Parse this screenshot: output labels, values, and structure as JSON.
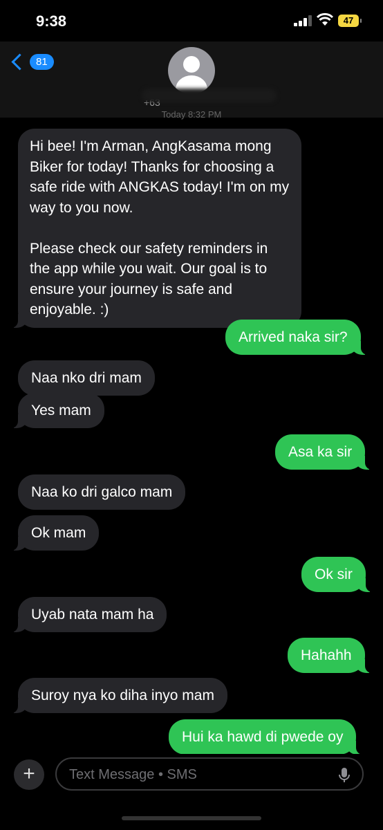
{
  "status_bar": {
    "time": "9:38",
    "battery": "47"
  },
  "header": {
    "back_count": "81",
    "contact_partial": "+63"
  },
  "timestamp": "Today 8:32 PM",
  "messages": [
    {
      "dir": "in",
      "text": "Hi bee! I'm Arman, AngKasama mong Biker for today! Thanks for choosing a safe ride with ANGKAS today! I'm on my way to you now.\n\nPlease check our safety reminders in the app while you wait. Our goal is to ensure your journey is safe and enjoyable. :)"
    },
    {
      "dir": "out",
      "text": "Arrived naka sir?"
    },
    {
      "dir": "in",
      "text": "Naa nko dri mam"
    },
    {
      "dir": "in",
      "text": "Yes mam"
    },
    {
      "dir": "out",
      "text": "Asa ka sir"
    },
    {
      "dir": "in",
      "text": "Naa ko dri galco mam"
    },
    {
      "dir": "in",
      "text": "Ok mam"
    },
    {
      "dir": "out",
      "text": "Ok sir"
    },
    {
      "dir": "in",
      "text": "Uyab nata mam ha"
    },
    {
      "dir": "out",
      "text": "Hahahh"
    },
    {
      "dir": "in",
      "text": "Suroy nya ko diha inyo mam"
    },
    {
      "dir": "out",
      "text": "Hui ka hawd di pwede oy"
    }
  ],
  "composer": {
    "placeholder": "Text Message • SMS"
  },
  "colors": {
    "incoming": "#26262a",
    "outgoing": "#2fc455",
    "accent": "#1a8cff"
  },
  "icons": {
    "back": "chevron-left-icon",
    "avatar": "person-icon",
    "add": "plus-icon",
    "mic": "microphone-icon"
  }
}
